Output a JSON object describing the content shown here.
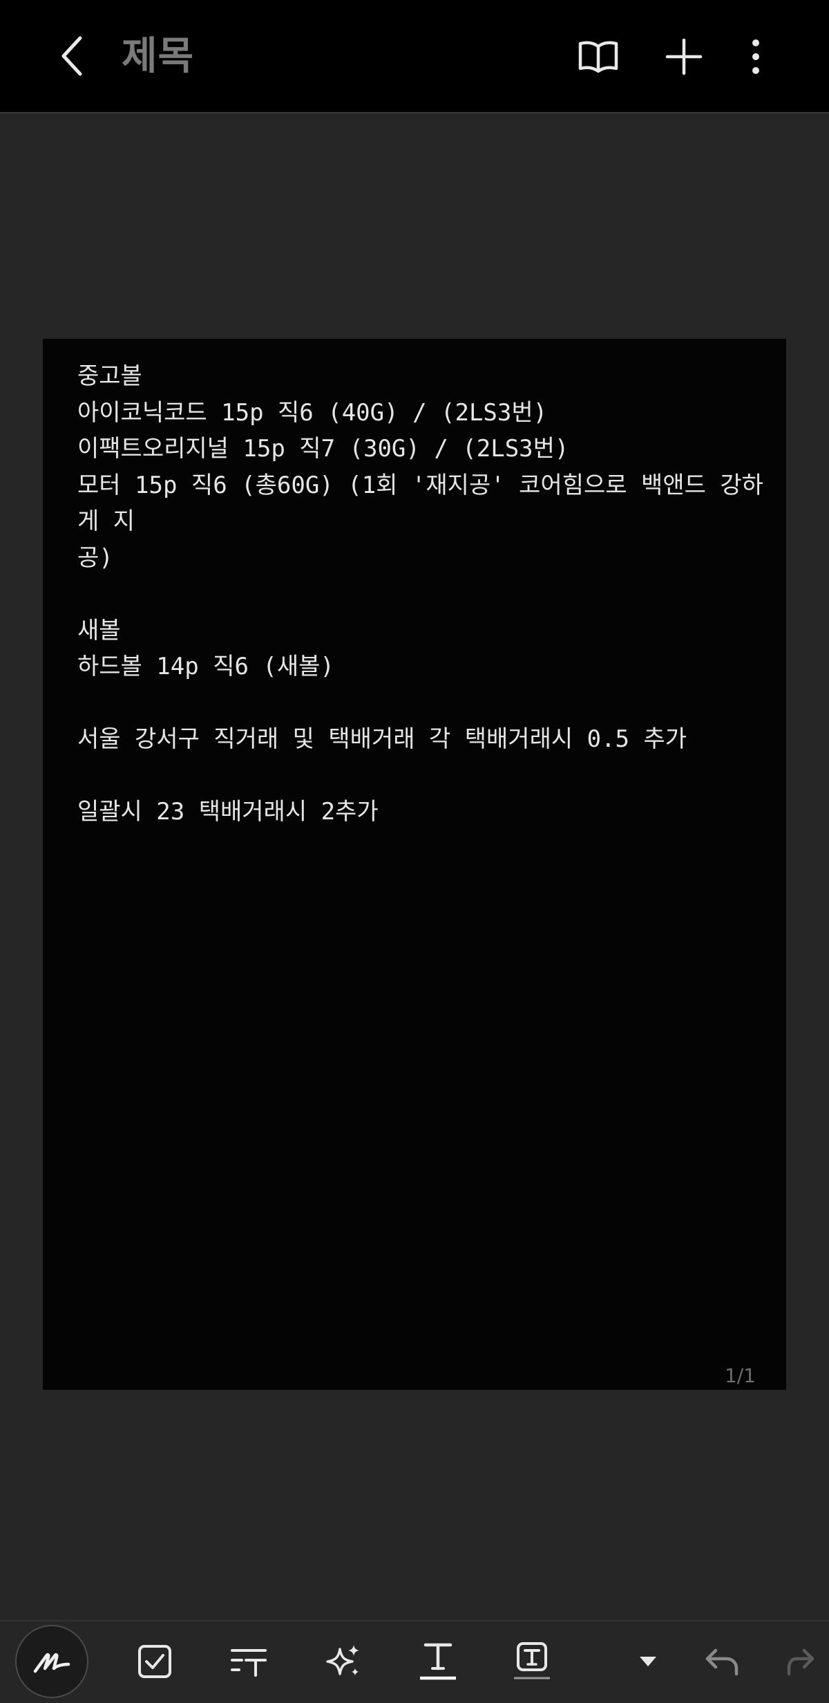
{
  "header": {
    "title": "제목",
    "icons": {
      "back": "chevron-left-icon",
      "reading_mode": "open-book-icon",
      "add": "plus-icon",
      "more": "more-vertical-icon"
    }
  },
  "note": {
    "text": "중고볼\n아이코닉코드 15p 직6 (40G) / (2LS3번)\n이팩트오리지널 15p 직7 (30G) / (2LS3번)\n모터 15p 직6 (총60G) (1회 '재지공' 코어힘으로 백앤드 강하게 지\n공)\n\n새볼\n하드볼 14p 직6 (새볼)\n\n서울 강서구 직거래 및 택배거래 각 택배거래시 0.5 추가\n\n일괄시 23 택배거래시 2추가",
    "page_indicator": "1/1"
  },
  "toolbar": {
    "tools": [
      "pen-icon",
      "checkbox-icon",
      "text-format-icon",
      "ai-sparkle-icon",
      "text-style-icon",
      "text-box-icon",
      "dropdown-icon",
      "undo-icon",
      "redo-icon"
    ]
  },
  "colors": {
    "background": "#262626",
    "topbar": "#000000",
    "page": "#040404",
    "text": "#e6e6e6",
    "title": "#7a7a7a"
  }
}
